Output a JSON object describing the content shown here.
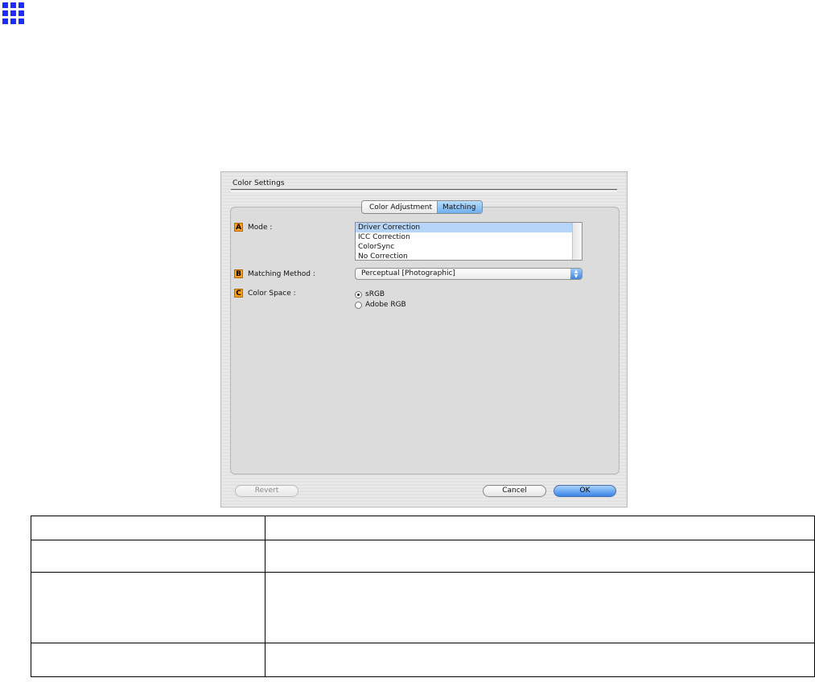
{
  "dialog": {
    "title": "Color Settings",
    "tabs": [
      "Color Adjustment",
      "Matching"
    ],
    "active_tab": "Matching",
    "mode": {
      "badge": "A",
      "label": "Mode :",
      "options": [
        "Driver Correction",
        "ICC Correction",
        "ColorSync",
        "No Correction"
      ],
      "selected": "Driver Correction"
    },
    "matching_method": {
      "badge": "B",
      "label": "Matching Method :",
      "value": "Perceptual [Photographic]",
      "arrow_up": "▲",
      "arrow_down": "▼"
    },
    "color_space": {
      "badge": "C",
      "label": "Color Space :",
      "options": [
        "sRGB",
        "Adobe RGB"
      ],
      "selected": "sRGB"
    },
    "buttons": {
      "revert": "Revert",
      "cancel": "Cancel",
      "ok": "OK"
    }
  },
  "accent_color": "#3a84e6",
  "badge_color": "#ff9d1c"
}
